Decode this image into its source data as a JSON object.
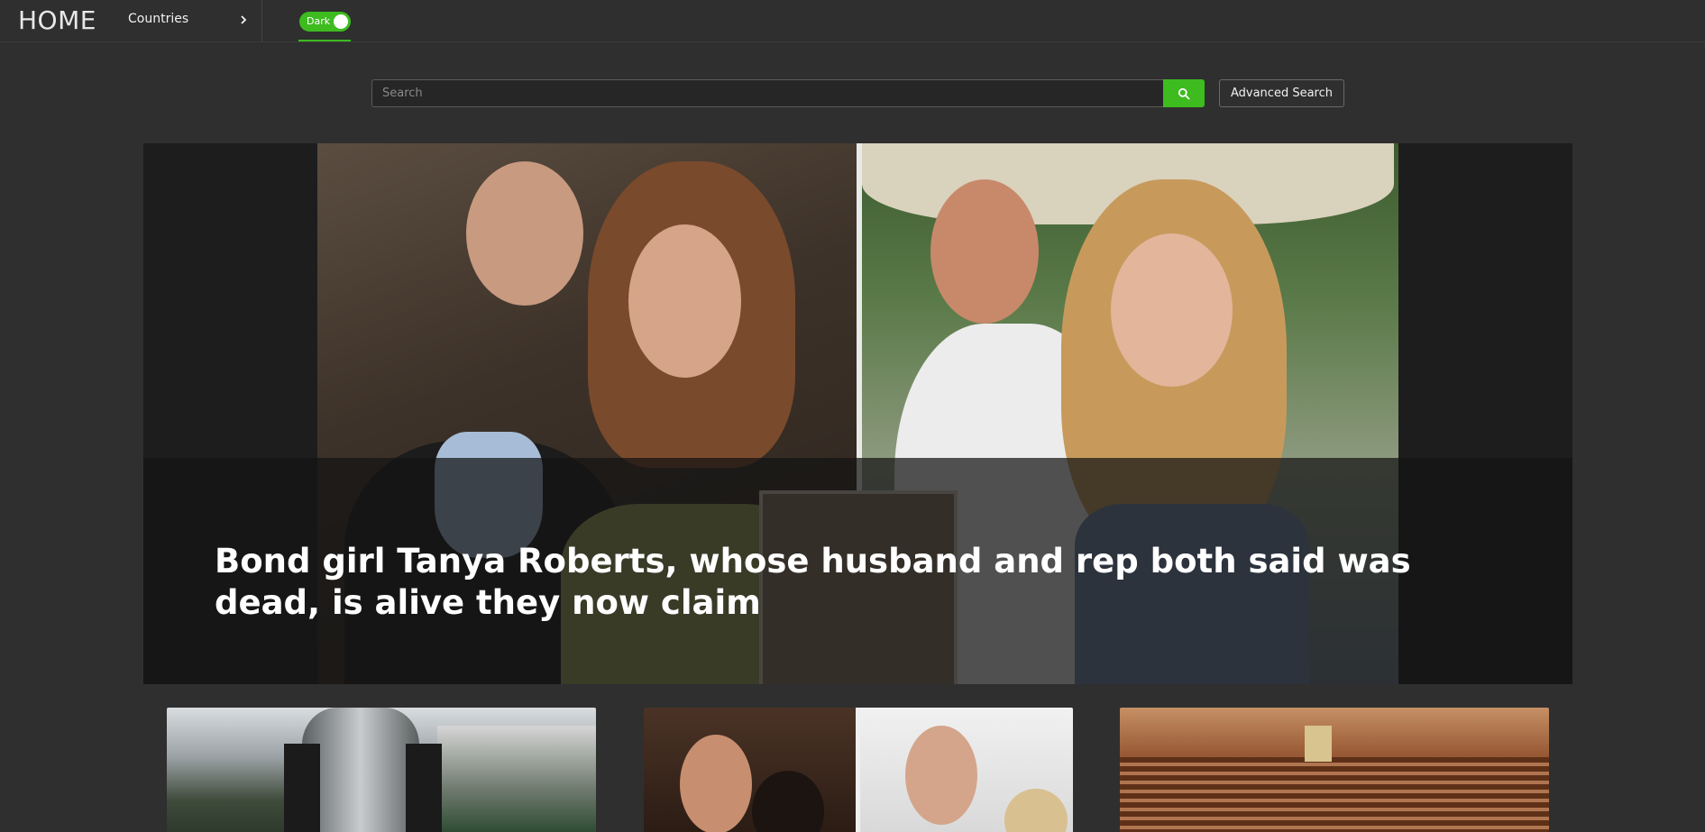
{
  "header": {
    "brand": "HOME",
    "countries_label": "Countries",
    "theme_toggle_label": "Dark"
  },
  "search": {
    "placeholder": "Search",
    "value": "",
    "advanced_label": "Advanced Search"
  },
  "hero": {
    "title": "Bond girl Tanya Roberts, whose husband and rep both said was dead, is alive they now claim"
  },
  "colors": {
    "accent": "#3dbb1f",
    "background": "#2f2f2f",
    "hero_background": "#1d1d1d"
  },
  "icons": {
    "search": "search-icon",
    "chevron": "chevron-right-icon"
  }
}
